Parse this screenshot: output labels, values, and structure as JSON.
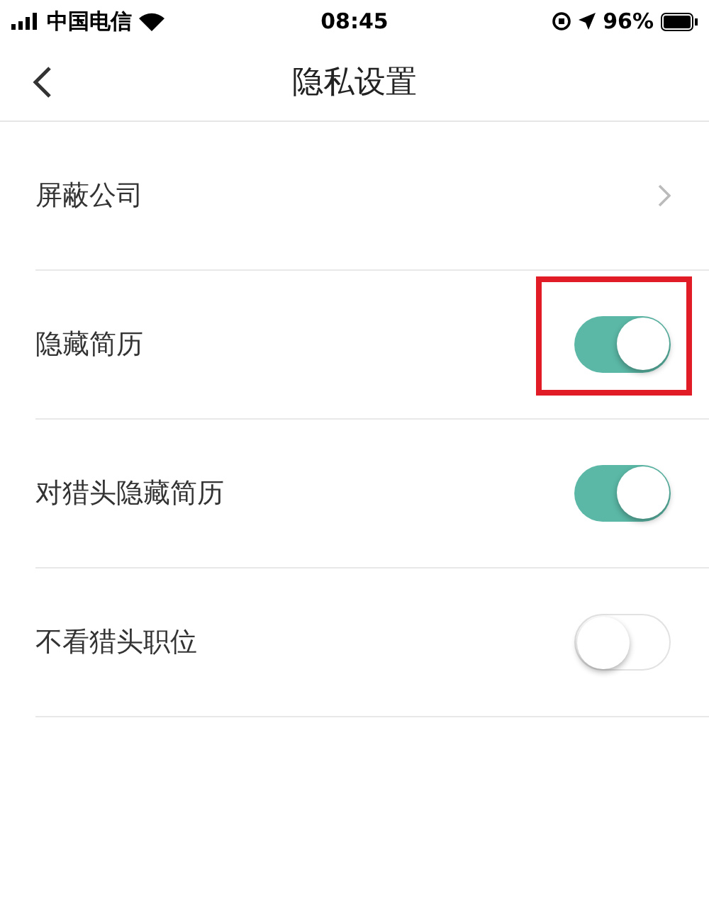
{
  "status_bar": {
    "carrier": "中国电信",
    "time": "08:45",
    "battery": "96%"
  },
  "nav": {
    "title": "隐私设置"
  },
  "settings": [
    {
      "kind": "link",
      "label": "屏蔽公司",
      "highlighted": false
    },
    {
      "kind": "toggle",
      "label": "隐藏简历",
      "on": true,
      "highlighted": true
    },
    {
      "kind": "toggle",
      "label": "对猎头隐藏简历",
      "on": true,
      "highlighted": false
    },
    {
      "kind": "toggle",
      "label": "不看猎头职位",
      "on": false,
      "highlighted": false
    }
  ]
}
